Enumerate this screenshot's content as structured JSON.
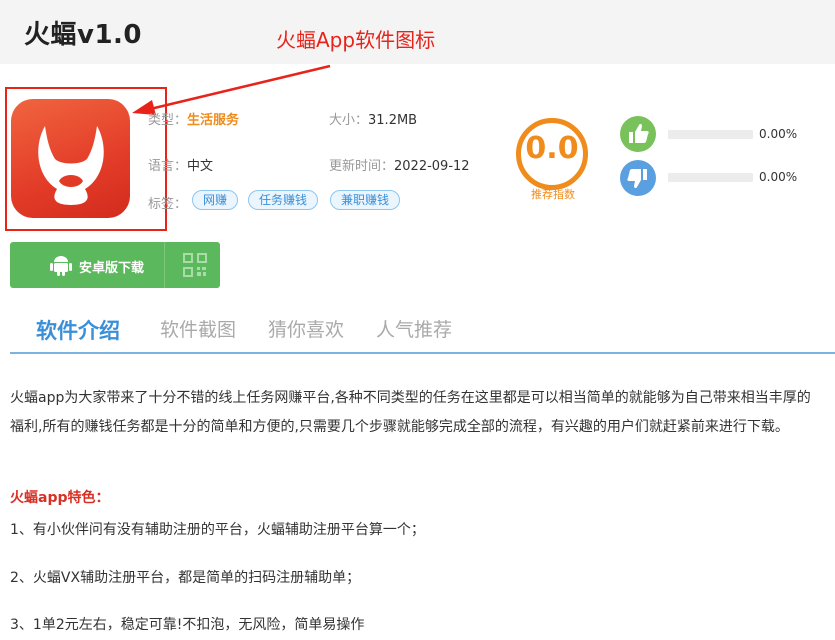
{
  "header": {
    "title": "火蝠v1.0"
  },
  "annotation": {
    "text": "火蝠App软件图标"
  },
  "app": {
    "type_label": "类型：",
    "type_value": "生活服务",
    "size_label": "大小：",
    "size_value": "31.2MB",
    "lang_label": "语言：",
    "lang_value": "中文",
    "update_label": "更新时间：",
    "update_value": "2022-09-12",
    "tags_label": "标签：",
    "tags": [
      "网赚",
      "任务赚钱",
      "兼职赚钱"
    ]
  },
  "rating": {
    "score": "0.0",
    "label": "推荐指数"
  },
  "votes": {
    "up_pct": "0.00%",
    "down_pct": "0.00%",
    "up_fraction": 0,
    "down_fraction": 0
  },
  "download": {
    "label": "安卓版下载"
  },
  "tabs": [
    "软件介绍",
    "软件截图",
    "猜你喜欢",
    "人气推荐"
  ],
  "content": {
    "intro": "火蝠app为大家带来了十分不错的线上任务网赚平台,各种不同类型的任务在这里都是可以相当简单的就能够为自己带来相当丰厚的福利,所有的赚钱任务都是十分的简单和方便的,只需要几个步骤就能够完成全部的流程，有兴趣的用户们就赶紧前来进行下载。",
    "features_heading": "火蝠app特色：",
    "features": [
      "1、有小伙伴问有没有辅助注册的平台，火蝠辅助注册平台算一个；",
      "2、火蝠VX辅助注册平台，都是简单的扫码注册辅助单；",
      "3、1单2元左右，稳定可靠!不扣泡，无风险，简单易操作"
    ]
  },
  "colors": {
    "accent_blue": "#3a8fd8",
    "orange": "#f08c1c",
    "green": "#5cb85c",
    "red": "#e8231a"
  }
}
